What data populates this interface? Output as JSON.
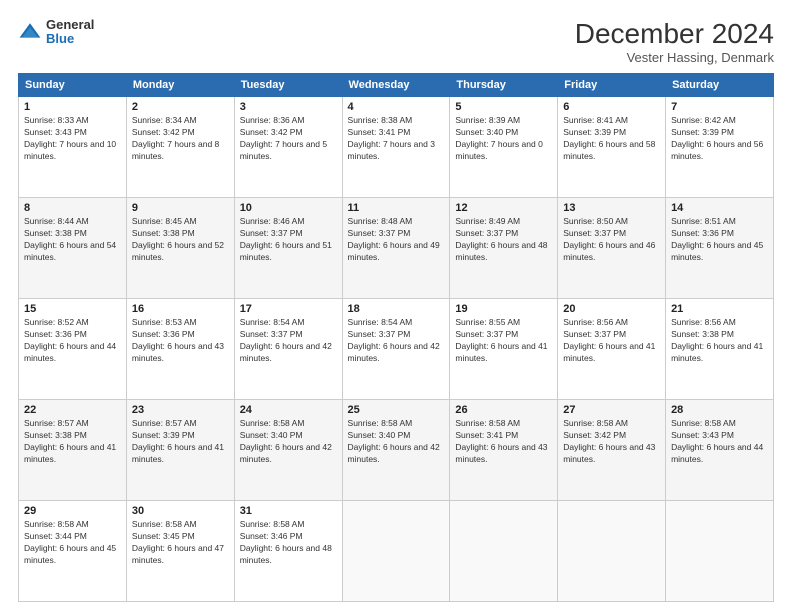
{
  "logo": {
    "general": "General",
    "blue": "Blue"
  },
  "header": {
    "month": "December 2024",
    "location": "Vester Hassing, Denmark"
  },
  "days_of_week": [
    "Sunday",
    "Monday",
    "Tuesday",
    "Wednesday",
    "Thursday",
    "Friday",
    "Saturday"
  ],
  "weeks": [
    [
      {
        "day": "1",
        "sunrise": "8:33 AM",
        "sunset": "3:43 PM",
        "daylight": "7 hours and 10 minutes."
      },
      {
        "day": "2",
        "sunrise": "8:34 AM",
        "sunset": "3:42 PM",
        "daylight": "7 hours and 8 minutes."
      },
      {
        "day": "3",
        "sunrise": "8:36 AM",
        "sunset": "3:42 PM",
        "daylight": "7 hours and 5 minutes."
      },
      {
        "day": "4",
        "sunrise": "8:38 AM",
        "sunset": "3:41 PM",
        "daylight": "7 hours and 3 minutes."
      },
      {
        "day": "5",
        "sunrise": "8:39 AM",
        "sunset": "3:40 PM",
        "daylight": "7 hours and 0 minutes."
      },
      {
        "day": "6",
        "sunrise": "8:41 AM",
        "sunset": "3:39 PM",
        "daylight": "6 hours and 58 minutes."
      },
      {
        "day": "7",
        "sunrise": "8:42 AM",
        "sunset": "3:39 PM",
        "daylight": "6 hours and 56 minutes."
      }
    ],
    [
      {
        "day": "8",
        "sunrise": "8:44 AM",
        "sunset": "3:38 PM",
        "daylight": "6 hours and 54 minutes."
      },
      {
        "day": "9",
        "sunrise": "8:45 AM",
        "sunset": "3:38 PM",
        "daylight": "6 hours and 52 minutes."
      },
      {
        "day": "10",
        "sunrise": "8:46 AM",
        "sunset": "3:37 PM",
        "daylight": "6 hours and 51 minutes."
      },
      {
        "day": "11",
        "sunrise": "8:48 AM",
        "sunset": "3:37 PM",
        "daylight": "6 hours and 49 minutes."
      },
      {
        "day": "12",
        "sunrise": "8:49 AM",
        "sunset": "3:37 PM",
        "daylight": "6 hours and 48 minutes."
      },
      {
        "day": "13",
        "sunrise": "8:50 AM",
        "sunset": "3:37 PM",
        "daylight": "6 hours and 46 minutes."
      },
      {
        "day": "14",
        "sunrise": "8:51 AM",
        "sunset": "3:36 PM",
        "daylight": "6 hours and 45 minutes."
      }
    ],
    [
      {
        "day": "15",
        "sunrise": "8:52 AM",
        "sunset": "3:36 PM",
        "daylight": "6 hours and 44 minutes."
      },
      {
        "day": "16",
        "sunrise": "8:53 AM",
        "sunset": "3:36 PM",
        "daylight": "6 hours and 43 minutes."
      },
      {
        "day": "17",
        "sunrise": "8:54 AM",
        "sunset": "3:37 PM",
        "daylight": "6 hours and 42 minutes."
      },
      {
        "day": "18",
        "sunrise": "8:54 AM",
        "sunset": "3:37 PM",
        "daylight": "6 hours and 42 minutes."
      },
      {
        "day": "19",
        "sunrise": "8:55 AM",
        "sunset": "3:37 PM",
        "daylight": "6 hours and 41 minutes."
      },
      {
        "day": "20",
        "sunrise": "8:56 AM",
        "sunset": "3:37 PM",
        "daylight": "6 hours and 41 minutes."
      },
      {
        "day": "21",
        "sunrise": "8:56 AM",
        "sunset": "3:38 PM",
        "daylight": "6 hours and 41 minutes."
      }
    ],
    [
      {
        "day": "22",
        "sunrise": "8:57 AM",
        "sunset": "3:38 PM",
        "daylight": "6 hours and 41 minutes."
      },
      {
        "day": "23",
        "sunrise": "8:57 AM",
        "sunset": "3:39 PM",
        "daylight": "6 hours and 41 minutes."
      },
      {
        "day": "24",
        "sunrise": "8:58 AM",
        "sunset": "3:40 PM",
        "daylight": "6 hours and 42 minutes."
      },
      {
        "day": "25",
        "sunrise": "8:58 AM",
        "sunset": "3:40 PM",
        "daylight": "6 hours and 42 minutes."
      },
      {
        "day": "26",
        "sunrise": "8:58 AM",
        "sunset": "3:41 PM",
        "daylight": "6 hours and 43 minutes."
      },
      {
        "day": "27",
        "sunrise": "8:58 AM",
        "sunset": "3:42 PM",
        "daylight": "6 hours and 43 minutes."
      },
      {
        "day": "28",
        "sunrise": "8:58 AM",
        "sunset": "3:43 PM",
        "daylight": "6 hours and 44 minutes."
      }
    ],
    [
      {
        "day": "29",
        "sunrise": "8:58 AM",
        "sunset": "3:44 PM",
        "daylight": "6 hours and 45 minutes."
      },
      {
        "day": "30",
        "sunrise": "8:58 AM",
        "sunset": "3:45 PM",
        "daylight": "6 hours and 47 minutes."
      },
      {
        "day": "31",
        "sunrise": "8:58 AM",
        "sunset": "3:46 PM",
        "daylight": "6 hours and 48 minutes."
      },
      null,
      null,
      null,
      null
    ]
  ]
}
